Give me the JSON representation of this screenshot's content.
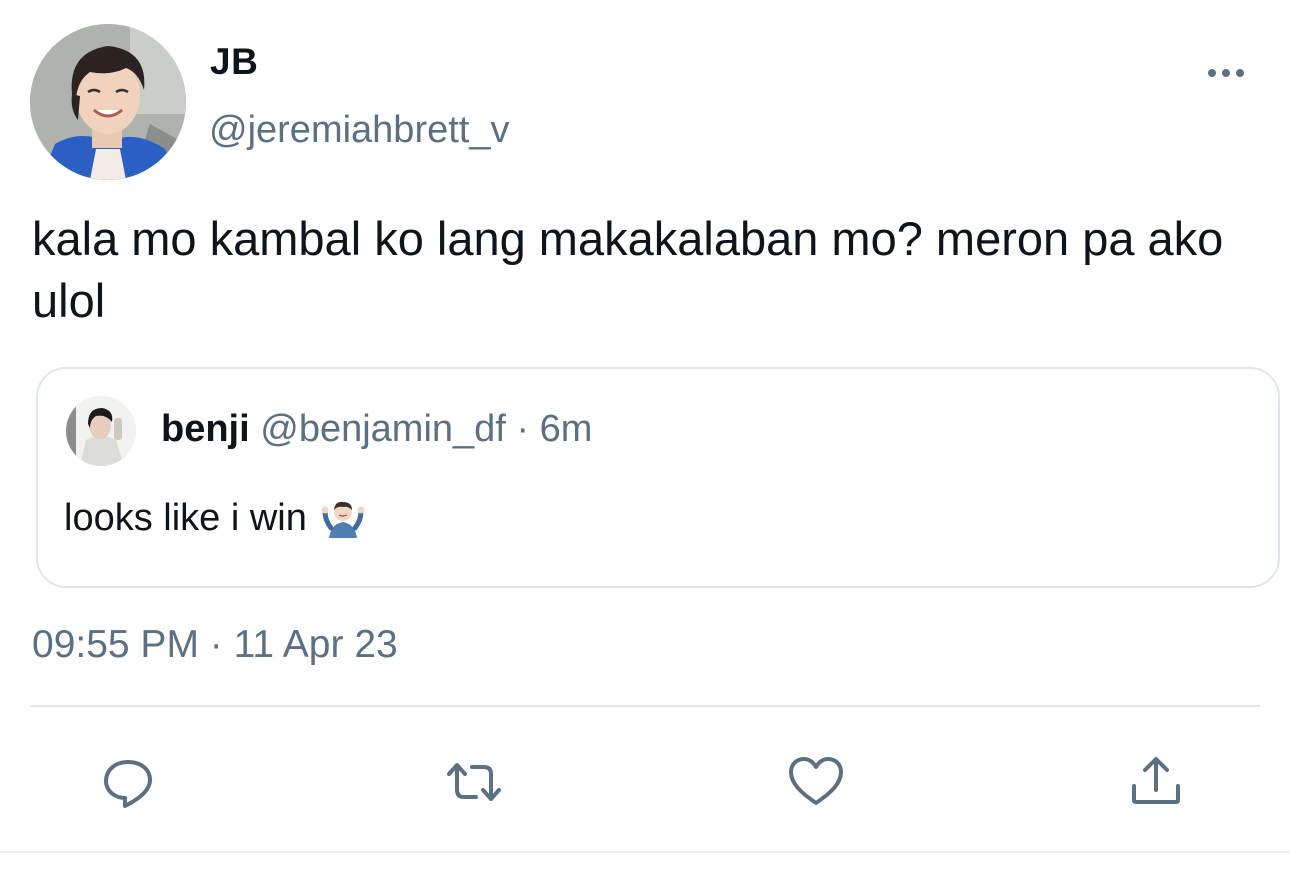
{
  "author": {
    "display_name": "JB",
    "handle": "@jeremiahbrett_v"
  },
  "tweet": {
    "text": "kala mo kambal ko lang makakalaban mo? meron pa ako ulol",
    "timestamp_time": "09:55 PM",
    "timestamp_sep": "·",
    "timestamp_date": "11 Apr 23"
  },
  "quoted": {
    "display_name": "benji",
    "handle": "@benjamin_df",
    "sep": "·",
    "time": "6m",
    "text": "looks like i win",
    "emoji": "shrug-emoji"
  },
  "actions": {
    "reply_icon": "reply-icon",
    "retweet_icon": "retweet-icon",
    "like_icon": "heart-icon",
    "share_icon": "share-icon"
  },
  "colors": {
    "text_primary": "#0f1419",
    "text_secondary": "#5b7083",
    "border": "#dfe5ea"
  }
}
